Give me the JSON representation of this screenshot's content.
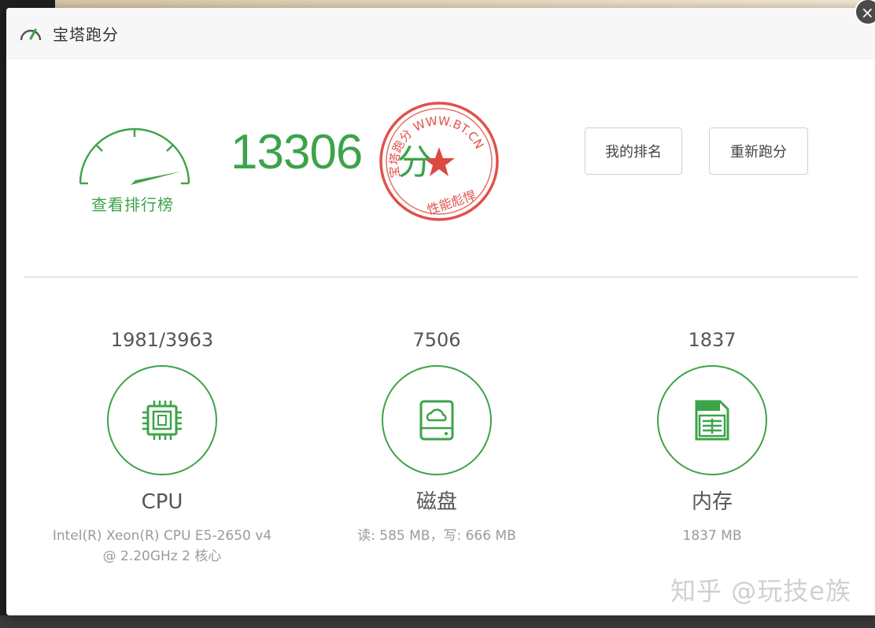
{
  "dialog": {
    "title": "宝塔跑分"
  },
  "score": {
    "value": "13306",
    "unit": "分",
    "ranking_link": "查看排行榜",
    "stamp_text": "宝塔跑分 WWW.BT.CN",
    "stamp_motto": "性能彪悍"
  },
  "buttons": {
    "my_rank": "我的排名",
    "rerun": "重新跑分"
  },
  "metrics": [
    {
      "value": "1981/3963",
      "name": "CPU",
      "detail": "Intel(R) Xeon(R) CPU E5-2650 v4 @ 2.20GHz 2 核心",
      "icon": "cpu-icon"
    },
    {
      "value": "7506",
      "name": "磁盘",
      "detail": "读: 585 MB，写: 666 MB",
      "icon": "disk-icon"
    },
    {
      "value": "1837",
      "name": "内存",
      "detail": "1837 MB",
      "icon": "memory-icon"
    }
  ],
  "watermark": "知乎 @玩技e族",
  "colors": {
    "accent": "#3da349",
    "stamp": "#d9342b"
  }
}
